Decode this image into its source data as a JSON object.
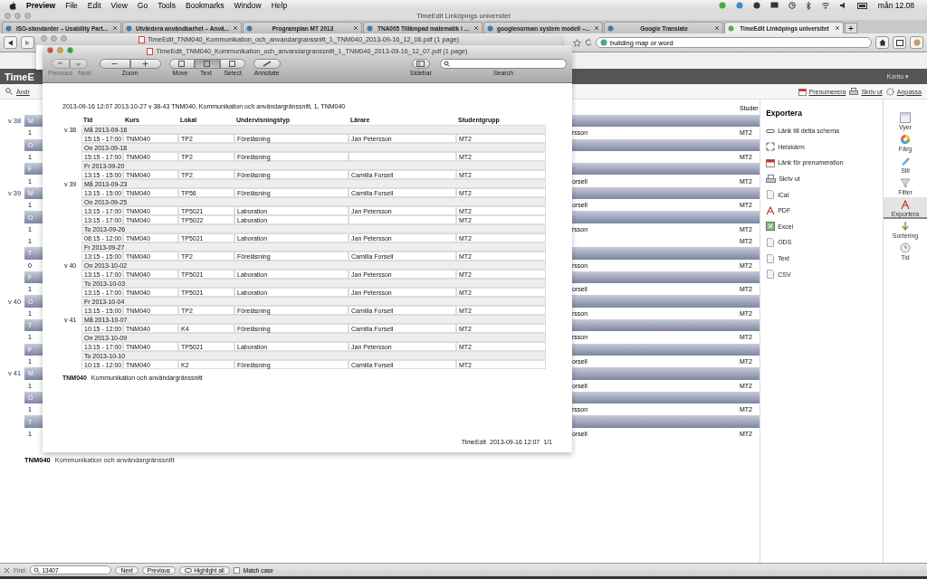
{
  "menubar": {
    "app": "Preview",
    "items": [
      "File",
      "Edit",
      "View",
      "Go",
      "Tools",
      "Bookmarks",
      "Window",
      "Help"
    ],
    "clock": "mån 12.08"
  },
  "browser": {
    "title": "TimeEdit Linköpings universitet",
    "tabs": [
      {
        "label": "ISO-standarder – Usability Part...",
        "selected": false
      },
      {
        "label": "Utvärdera användbarhet – Anvä...",
        "selected": false
      },
      {
        "label": "Programplan MT 2013",
        "selected": false
      },
      {
        "label": "TNA005 Tillämpad matematik i ...",
        "selected": false
      },
      {
        "label": "googlenorman system modell –...",
        "selected": false
      },
      {
        "label": "Google Translate",
        "selected": false
      },
      {
        "label": "TimeEdit Linköpings universitet",
        "selected": true
      }
    ],
    "new_tab": "+",
    "search": {
      "value": "building map or word"
    }
  },
  "timeedit": {
    "logo": "TimeE",
    "account": "Konto ▾",
    "toolbar_left": "Ändr",
    "actions": [
      "Prenumerera",
      "Skriv ut",
      "Anpassa"
    ],
    "column_header": "Studer",
    "rows": [
      {
        "kind": "day",
        "week": "v 38",
        "text": "M"
      },
      {
        "kind": "event",
        "text": "1",
        "name": "rsson",
        "group": "MT2"
      },
      {
        "kind": "day",
        "text": "O"
      },
      {
        "kind": "event",
        "text": "1",
        "group": "MT2"
      },
      {
        "kind": "day",
        "text": "F"
      },
      {
        "kind": "event",
        "text": "1",
        "name": "orsell",
        "group": "MT2"
      },
      {
        "kind": "day",
        "week": "v 39",
        "text": "M"
      },
      {
        "kind": "event",
        "text": "1",
        "name": "orsell",
        "group": "MT2"
      },
      {
        "kind": "day",
        "text": "O"
      },
      {
        "kind": "event",
        "text": "1",
        "name": "rsson",
        "group": "MT2"
      },
      {
        "kind": "event",
        "text": "1",
        "group": "MT2"
      },
      {
        "kind": "day",
        "text": "T"
      },
      {
        "kind": "event",
        "text": "0",
        "name": "rsson",
        "group": "MT2"
      },
      {
        "kind": "day",
        "text": "F"
      },
      {
        "kind": "event",
        "text": "1",
        "name": "orsell",
        "group": "MT2"
      },
      {
        "kind": "day",
        "week": "v 40",
        "text": "O"
      },
      {
        "kind": "event",
        "text": "1",
        "name": "rsson",
        "group": "MT2"
      },
      {
        "kind": "day",
        "text": "T"
      },
      {
        "kind": "event",
        "text": "1",
        "name": "rsson",
        "group": "MT2"
      },
      {
        "kind": "day",
        "text": "F"
      },
      {
        "kind": "event",
        "text": "1",
        "name": "orsell",
        "group": "MT2"
      },
      {
        "kind": "day",
        "week": "v 41",
        "text": "M"
      },
      {
        "kind": "event",
        "text": "1",
        "name": "orsell",
        "group": "MT2"
      },
      {
        "kind": "day",
        "text": "O"
      },
      {
        "kind": "event",
        "text": "1",
        "name": "rsson",
        "group": "MT2"
      },
      {
        "kind": "day",
        "text": "T"
      },
      {
        "kind": "event",
        "text": "1",
        "name": "orsell",
        "group": "MT2"
      }
    ],
    "footer": {
      "code": "TNM040",
      "name": "Kommunikation och användargränssnitt"
    },
    "export_panel": {
      "title": "Exportera",
      "items": [
        {
          "kind": "link",
          "label": "Länk till detta schema"
        },
        {
          "kind": "fullscreen",
          "label": "Helskärm"
        },
        {
          "kind": "calendar",
          "label": "Länk för prenumeration"
        },
        {
          "kind": "print",
          "label": "Skriv ut"
        },
        {
          "kind": "doc",
          "label": "iCal"
        },
        {
          "kind": "pdf",
          "label": "PDF"
        },
        {
          "kind": "excel",
          "label": "Excel"
        },
        {
          "kind": "doc",
          "label": "ODS"
        },
        {
          "kind": "doc",
          "label": "Text"
        },
        {
          "kind": "doc",
          "label": "CSV"
        }
      ]
    },
    "side_nav": [
      {
        "kind": "views",
        "label": "Vyer",
        "selected": false
      },
      {
        "kind": "color",
        "label": "Färg",
        "selected": false
      },
      {
        "kind": "style",
        "label": "Stil",
        "selected": false
      },
      {
        "kind": "filter",
        "label": "Filter",
        "selected": false
      },
      {
        "kind": "pdf",
        "label": "Exportera",
        "selected": true
      },
      {
        "kind": "sort",
        "label": "Sortering",
        "selected": false
      },
      {
        "kind": "time",
        "label": "Tid",
        "selected": false
      }
    ]
  },
  "find_bar": {
    "label": "Find:",
    "value": "13407",
    "buttons": [
      "Next",
      "Previous"
    ],
    "highlight": "Highlight all",
    "match_case": {
      "label": "Match case",
      "checked": false
    }
  },
  "preview_back": {
    "title": "TimeEdit_TNM040_Kommunikation_och_anvandargranssnitt_1_TNM040_2013-09-16_12_06.pdf (1 page)"
  },
  "preview": {
    "title": "TimeEdit_TNM040_Kommunikation_och_anvandargranssnitt_1_TNM040_2013-09-16_12_07.pdf (1 page)",
    "nav": [
      {
        "label": "Previous",
        "disabled": true
      },
      {
        "label": "Next",
        "disabled": true
      }
    ],
    "zoom_label": "Zoom",
    "modes": [
      {
        "label": "Move",
        "selected": false
      },
      {
        "label": "Text",
        "selected": true
      },
      {
        "label": "Select",
        "selected": false
      }
    ],
    "annotate": "Annotate",
    "sidebar": "Sidebar",
    "search_label": "Search",
    "document": {
      "header": "2013-09-16 12:07 2013-10-27 v 38-43  TNM040, Kommunikation och användargränssnitt, 1, TNM040",
      "columns": [
        "Tid",
        "Kurs",
        "Lokal",
        "Undervisningstyp",
        "Lärare",
        "Studentgrupp"
      ],
      "rows": [
        {
          "kind": "day",
          "week": "v 38",
          "date": "Må 2013-09-16"
        },
        {
          "kind": "event",
          "cells": [
            "15:15 - 17:00",
            "TNM040",
            "TP2",
            "Föreläsning",
            "Jan Petersson",
            "MT2"
          ]
        },
        {
          "kind": "day",
          "date": "On 2013-09-18"
        },
        {
          "kind": "event",
          "cells": [
            "15:15 - 17:00",
            "TNM040",
            "TP2",
            "Föreläsning",
            null,
            "MT2"
          ]
        },
        {
          "kind": "day",
          "date": "Fr 2013-09-20"
        },
        {
          "kind": "event",
          "cells": [
            "13:15 - 15:00",
            "TNM040",
            "TP2",
            "Föreläsning",
            "Camilla Forsell",
            "MT2"
          ]
        },
        {
          "kind": "day",
          "week": "v 39",
          "date": "Må 2013-09-23"
        },
        {
          "kind": "event",
          "cells": [
            "13:15 - 15:00",
            "TNM040",
            "TP56",
            "Föreläsning",
            "Camilla Forsell",
            "MT2"
          ]
        },
        {
          "kind": "day",
          "date": "On 2013-09-25"
        },
        {
          "kind": "event",
          "cells": [
            "13:15 - 17:00",
            "TNM040",
            "TP5021",
            "Laboration",
            "Jan Petersson",
            "MT2"
          ]
        },
        {
          "kind": "event",
          "cells": [
            "13:15 - 17:00",
            "TNM040",
            "TP5022",
            "Laboration",
            null,
            "MT2"
          ]
        },
        {
          "kind": "day",
          "date": "To 2013-09-26"
        },
        {
          "kind": "event",
          "cells": [
            "08:15 - 12:00",
            "TNM040",
            "TP5021",
            "Laboration",
            "Jan Petersson",
            "MT2"
          ]
        },
        {
          "kind": "day",
          "date": "Fr 2013-09-27"
        },
        {
          "kind": "event",
          "cells": [
            "13:15 - 15:00",
            "TNM040",
            "TP2",
            "Föreläsning",
            "Camilla Forsell",
            "MT2"
          ]
        },
        {
          "kind": "day",
          "week": "v 40",
          "date": "On 2013-10-02"
        },
        {
          "kind": "event",
          "cells": [
            "13:15 - 17:00",
            "TNM040",
            "TP5021",
            "Laboration",
            "Jan Petersson",
            "MT2"
          ]
        },
        {
          "kind": "day",
          "date": "To 2013-10-03"
        },
        {
          "kind": "event",
          "cells": [
            "13:15 - 17:00",
            "TNM040",
            "TP5021",
            "Laboration",
            "Jan Petersson",
            "MT2"
          ]
        },
        {
          "kind": "day",
          "date": "Fr 2013-10-04"
        },
        {
          "kind": "event",
          "cells": [
            "13:15 - 15:00",
            "TNM040",
            "TP2",
            "Föreläsning",
            "Camilla Forsell",
            "MT2"
          ]
        },
        {
          "kind": "day",
          "week": "v 41",
          "date": "Må 2013-10-07"
        },
        {
          "kind": "event",
          "cells": [
            "10:15 - 12:00",
            "TNM040",
            "K4",
            "Föreläsning",
            "Camilla Forsell",
            "MT2"
          ]
        },
        {
          "kind": "day",
          "date": "On 2013-10-09"
        },
        {
          "kind": "event",
          "cells": [
            "13:15 - 17:00",
            "TNM040",
            "TP5021",
            "Laboration",
            "Jan Petersson",
            "MT2"
          ]
        },
        {
          "kind": "day",
          "date": "To 2013-10-10"
        },
        {
          "kind": "event",
          "cells": [
            "10:15 - 12:00",
            "TNM040",
            "K2",
            "Föreläsning",
            "Camilla Forsell",
            "MT2"
          ]
        }
      ],
      "footer": {
        "code": "TNM040",
        "name": "Kommunikation och användargränssnitt"
      },
      "stamp": [
        "TimeEdit",
        "2013-09-16 12:07",
        "1/1"
      ]
    }
  }
}
